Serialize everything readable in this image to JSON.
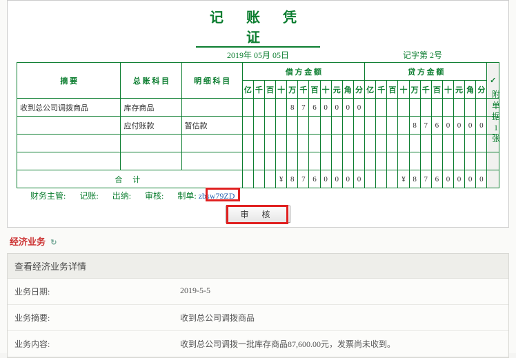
{
  "voucher": {
    "title": "记 账 凭 证",
    "date": "2019年 05月 05日",
    "number_label": "记字第 2号",
    "headers": {
      "summary": "摘   要",
      "account": "总 账 科 目",
      "subaccount": "明 细 科 目",
      "debit": "借  方  金  额",
      "credit": "贷  方  金  额",
      "check": "✓",
      "digits": [
        "亿",
        "千",
        "百",
        "十",
        "万",
        "千",
        "百",
        "十",
        "元",
        "角",
        "分"
      ]
    },
    "rows": [
      {
        "summary": "收到总公司调拨商品",
        "account": "库存商品",
        "sub": "",
        "debit": [
          "",
          "",
          "",
          "",
          "8",
          "7",
          "6",
          "0",
          "0",
          "0",
          "0"
        ],
        "credit": [
          "",
          "",
          "",
          "",
          "",
          "",
          "",
          "",
          "",
          "",
          ""
        ]
      },
      {
        "summary": "",
        "account": "应付账款",
        "sub": "暂估款",
        "debit": [
          "",
          "",
          "",
          "",
          "",
          "",
          "",
          "",
          "",
          "",
          ""
        ],
        "credit": [
          "",
          "",
          "",
          "",
          "8",
          "7",
          "6",
          "0",
          "0",
          "0",
          "0"
        ]
      },
      {
        "summary": "",
        "account": "",
        "sub": "",
        "debit": [
          "",
          "",
          "",
          "",
          "",
          "",
          "",
          "",
          "",
          "",
          ""
        ],
        "credit": [
          "",
          "",
          "",
          "",
          "",
          "",
          "",
          "",
          "",
          "",
          ""
        ]
      },
      {
        "summary": "",
        "account": "",
        "sub": "",
        "debit": [
          "",
          "",
          "",
          "",
          "",
          "",
          "",
          "",
          "",
          "",
          ""
        ],
        "credit": [
          "",
          "",
          "",
          "",
          "",
          "",
          "",
          "",
          "",
          "",
          ""
        ]
      }
    ],
    "total": {
      "label": "合                        计",
      "debit": [
        "",
        "",
        "",
        "¥",
        "8",
        "7",
        "6",
        "0",
        "0",
        "0",
        "0"
      ],
      "credit": [
        "",
        "",
        "",
        "¥",
        "8",
        "7",
        "6",
        "0",
        "0",
        "0",
        "0"
      ]
    },
    "attach_label": "附单据",
    "attach_count": "1",
    "attach_unit": "张",
    "signatures": {
      "fin_mgr": "财务主管:",
      "book": "记账:",
      "cashier": "出纳:",
      "audit": "审核:",
      "maker_label": "制单:",
      "maker_value": "zbsw79ZD"
    }
  },
  "audit_button": "审 核",
  "business": {
    "tab": "经济业务",
    "panel_title": "查看经济业务详情",
    "rows": [
      {
        "label": "业务日期:",
        "value": "2019-5-5"
      },
      {
        "label": "业务摘要:",
        "value": "收到总公司调拨商品"
      },
      {
        "label": "业务内容:",
        "value": "收到总公司调拨一批库存商品87,600.00元，发票尚未收到。"
      }
    ]
  }
}
